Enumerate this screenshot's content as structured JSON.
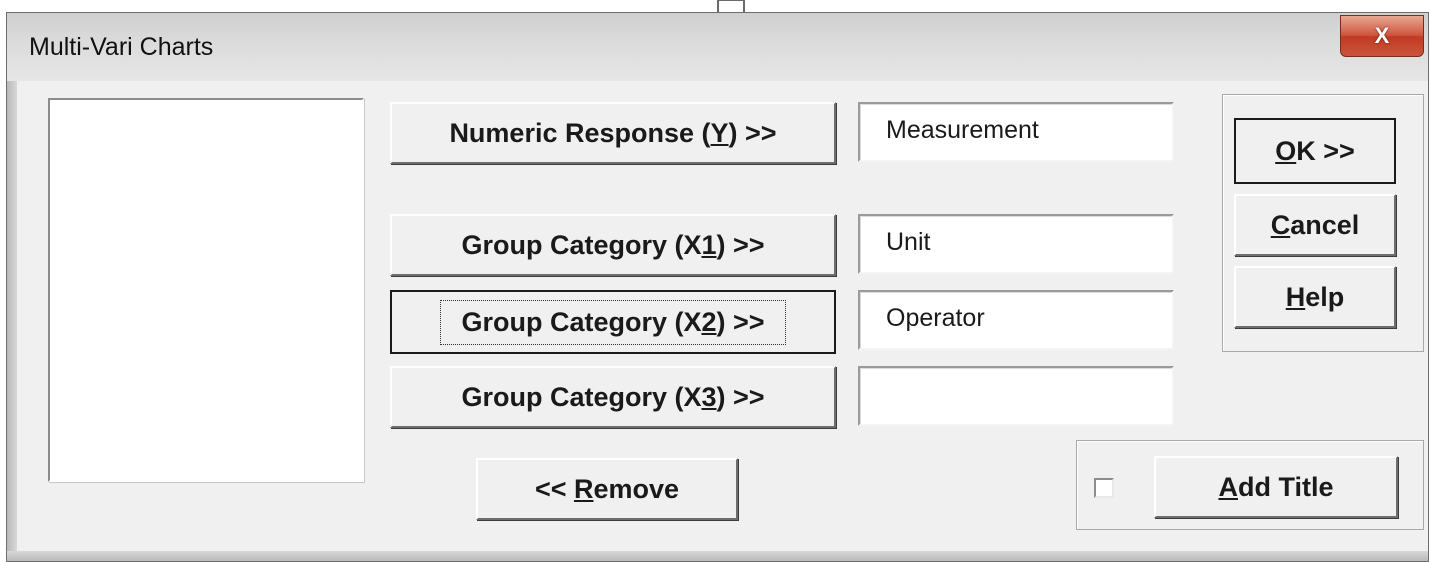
{
  "window": {
    "title": "Multi-Vari Charts",
    "close_label": "X"
  },
  "buttons": {
    "numeric_response": {
      "pre": "Numeric Response (",
      "key": "Y",
      "post": ") >>"
    },
    "group_x1": {
      "pre": "Group Category (X",
      "key": "1",
      "post": ") >>"
    },
    "group_x2": {
      "pre": "Group Category (X",
      "key": "2",
      "post": ") >>"
    },
    "group_x3": {
      "pre": "Group Category (X",
      "key": "3",
      "post": ") >>"
    },
    "remove": {
      "pre": "<< ",
      "key": "R",
      "post": "emove"
    },
    "ok": {
      "pre": "",
      "key": "O",
      "post": "K >>"
    },
    "cancel": {
      "pre": "",
      "key": "C",
      "post": "ancel"
    },
    "help": {
      "pre": "",
      "key": "H",
      "post": "elp"
    },
    "add_title": {
      "pre": "",
      "key": "A",
      "post": "dd Title"
    }
  },
  "fields": {
    "numeric_response": "Measurement",
    "group_x1": "Unit",
    "group_x2": "Operator",
    "group_x3": ""
  },
  "add_title_checked": false,
  "icons": {
    "arrow": "down-arrow-icon",
    "close": "close-icon"
  }
}
